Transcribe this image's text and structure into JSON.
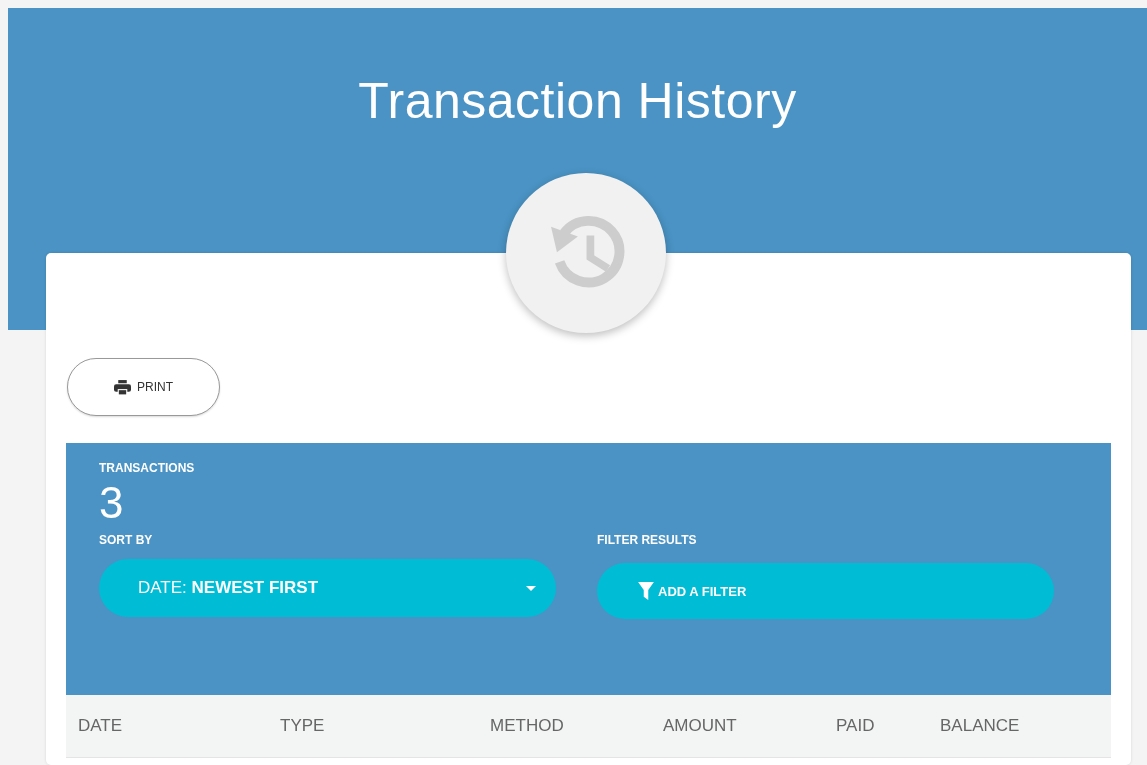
{
  "header": {
    "title": "Transaction History"
  },
  "print_button": {
    "label": "PRINT"
  },
  "summary": {
    "label": "TRANSACTIONS",
    "count": "3"
  },
  "sort": {
    "label": "SORT BY",
    "value": "DATE: **NEWEST FIRST**"
  },
  "filter": {
    "label": "FILTER RESULTS",
    "button": "ADD A FILTER"
  },
  "table": {
    "columns": [
      "DATE",
      "TYPE",
      "METHOD",
      "AMOUNT",
      "PAID",
      "BALANCE"
    ]
  }
}
